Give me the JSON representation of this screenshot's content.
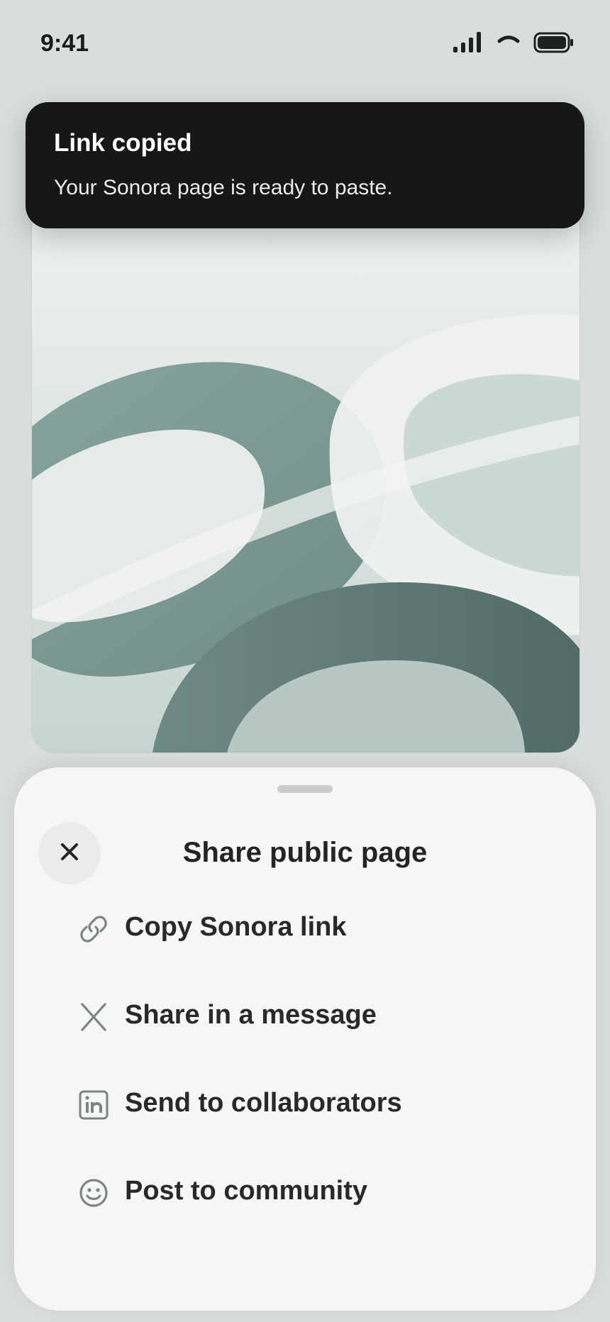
{
  "status_bar": {
    "time": "9:41",
    "icons": [
      "cellular-signal-icon",
      "wifi-icon",
      "battery-icon"
    ]
  },
  "toast": {
    "title": "Link copied",
    "message": "Your Sonora page is ready to paste."
  },
  "artwork": {
    "palette": [
      "#e6ebe8",
      "#8ea8a1",
      "#5f7b76",
      "#f1f3f0"
    ]
  },
  "share_sheet": {
    "title": "Share public page",
    "close_icon": "close-icon",
    "actions": [
      {
        "label": "Copy Sonora link",
        "icon": "link-icon"
      },
      {
        "label": "Share in a message",
        "icon": "x-logo-icon"
      },
      {
        "label": "Send to collaborators",
        "icon": "linkedin-icon"
      },
      {
        "label": "Post to community",
        "icon": "smiley-icon"
      }
    ]
  },
  "colors": {
    "background": "#d9dedd",
    "toast": "#161817",
    "sheet": "#f6f7f5",
    "icon": "#7b8583"
  }
}
